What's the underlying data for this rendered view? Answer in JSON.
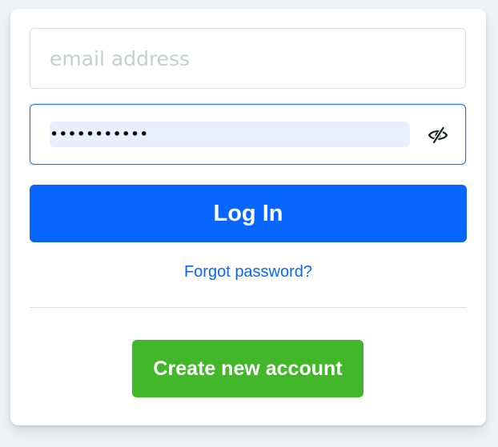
{
  "login_form": {
    "email": {
      "placeholder": "email address",
      "value": ""
    },
    "password": {
      "value": "•••••••••••",
      "autofilled": true,
      "toggle_icon": "eye-slash-icon"
    },
    "login_label": "Log In",
    "forgot_password_label": "Forgot password?",
    "create_account_label": "Create new account"
  },
  "colors": {
    "page_background": "#f0f2f5",
    "card_background": "#ffffff",
    "primary_blue": "#0866ff",
    "focus_border": "#1877f2",
    "autofill_background": "#e8f0fe",
    "create_green": "#42b72a",
    "divider": "#dadde1",
    "placeholder_text": "#c9ccd1"
  }
}
